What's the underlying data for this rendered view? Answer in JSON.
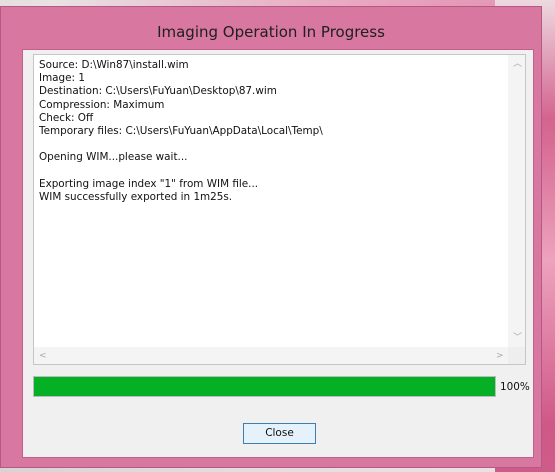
{
  "window": {
    "title": "Imaging Operation In Progress"
  },
  "log": {
    "lines": [
      "Source: D:\\Win87\\install.wim",
      "Image: 1",
      "Destination: C:\\Users\\FuYuan\\Desktop\\87.wim",
      "Compression: Maximum",
      "Check: Off",
      "Temporary files: C:\\Users\\FuYuan\\AppData\\Local\\Temp\\",
      "",
      "Opening WIM...please wait...",
      "",
      "Exporting image index \"1\" from WIM file...",
      "WIM successfully exported in 1m25s."
    ]
  },
  "progress": {
    "fraction": 1.0,
    "label": "100%"
  },
  "buttons": {
    "close": "Close"
  },
  "colors": {
    "progress_fill": "#06b025",
    "frame": "#d877a0"
  },
  "icons": {
    "scroll_up": "up-arrow-icon",
    "scroll_down": "down-arrow-icon",
    "scroll_left": "left-arrow-icon",
    "scroll_right": "right-arrow-icon"
  }
}
